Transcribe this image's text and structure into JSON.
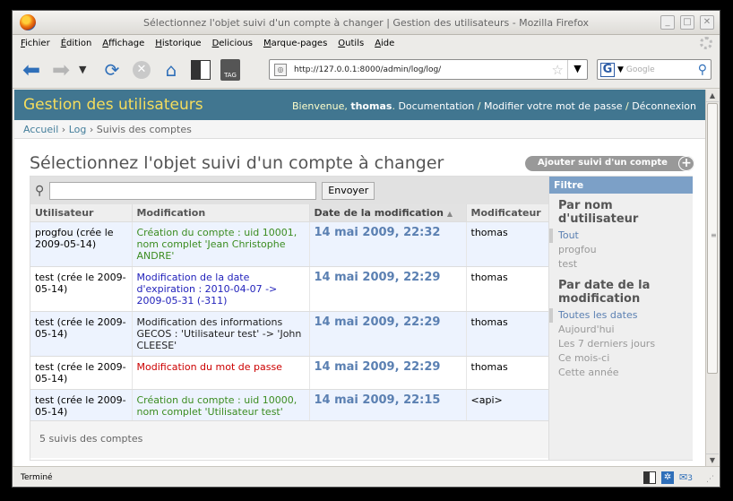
{
  "window": {
    "title": "Sélectionnez l'objet suivi d'un compte à changer | Gestion des utilisateurs - Mozilla Firefox"
  },
  "menu": [
    "Fichier",
    "Édition",
    "Affichage",
    "Historique",
    "Delicious",
    "Marque-pages",
    "Outils",
    "Aide"
  ],
  "nav": {
    "url": "http://127.0.0.1:8000/admin/log/log/",
    "search_placeholder": "Google",
    "tag_label": "TAG"
  },
  "header": {
    "brand": "Gestion des utilisateurs",
    "welcome": "Bienvenue, ",
    "username": "thomas",
    "links": [
      "Documentation",
      "Modifier votre mot de passe",
      "Déconnexion"
    ]
  },
  "breadcrumbs": [
    "Accueil",
    "Log",
    "Suivis des comptes"
  ],
  "page": {
    "title": "Sélectionnez l'objet suivi d'un compte à changer",
    "add_button": "Ajouter suivi d'un compte"
  },
  "search": {
    "button": "Envoyer",
    "value": ""
  },
  "table": {
    "columns": [
      "Utilisateur",
      "Modification",
      "Date de la modification",
      "Modificateur"
    ],
    "rows": [
      {
        "user": "progfou (crée le 2009-05-14)",
        "modification": "Création du compte : uid 10001, nom complet 'Jean Christophe ANDRE'",
        "color": "#3b8c20",
        "date": "14 mai 2009, 22:32",
        "modifier": "thomas"
      },
      {
        "user": "test (crée le 2009-05-14)",
        "modification": "Modification de la date d'expiration : 2010-04-07 -> 2009-05-31 (-311)",
        "color": "#2222bb",
        "date": "14 mai 2009, 22:29",
        "modifier": "thomas"
      },
      {
        "user": "test (crée le 2009-05-14)",
        "modification": "Modification des informations GECOS : 'Utilisateur test' -> 'John CLEESE'",
        "color": "#222222",
        "date": "14 mai 2009, 22:29",
        "modifier": "thomas"
      },
      {
        "user": "test (crée le 2009-05-14)",
        "modification": "Modification du mot de passe",
        "color": "#cc0000",
        "date": "14 mai 2009, 22:29",
        "modifier": "thomas"
      },
      {
        "user": "test (crée le 2009-05-14)",
        "modification": "Création du compte : uid 10000, nom complet 'Utilisateur test'",
        "color": "#3b8c20",
        "date": "14 mai 2009, 22:15",
        "modifier": "<api>"
      }
    ]
  },
  "paginator": "5 suivis des comptes",
  "filter": {
    "title": "Filtre",
    "groups": [
      {
        "title": "Par nom d'utilisateur",
        "options": [
          "Tout",
          "progfou",
          "test"
        ],
        "selected": 0
      },
      {
        "title": "Par date de la modification",
        "options": [
          "Toutes les dates",
          "Aujourd'hui",
          "Les 7 derniers jours",
          "Ce mois-ci",
          "Cette année"
        ],
        "selected": 0
      }
    ]
  },
  "statusbar": {
    "text": "Terminé",
    "mail_count": "3"
  }
}
